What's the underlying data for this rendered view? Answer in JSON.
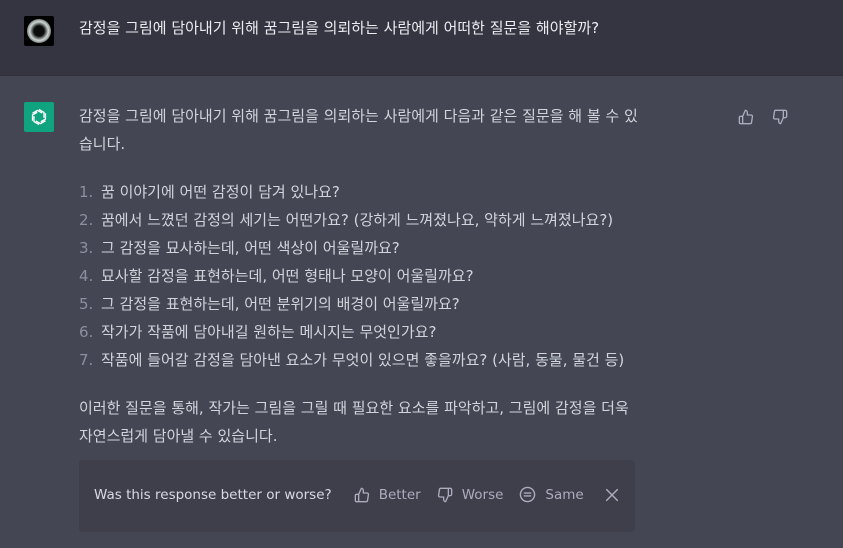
{
  "user_message": {
    "avatar": "user-avatar-orb",
    "text": "감정을 그림에 담아내기 위해 꿈그림을 의뢰하는 사람에게 어떠한 질문을 해야할까?"
  },
  "assistant_message": {
    "avatar": "openai-logo-icon",
    "accent_color": "#10a37f",
    "intro_line1": "감정을 그림에 담아내기 위해 꿈그림을 의뢰하는 사람에게 다음과 같은 질문을 해 볼 수 있",
    "intro_line2": "습니다.",
    "questions": [
      {
        "num": "1.",
        "text": "꿈 이야기에 어떤 감정이 담겨 있나요?"
      },
      {
        "num": "2.",
        "text": "꿈에서 느꼈던 감정의 세기는 어떤가요? (강하게 느껴졌나요, 약하게 느껴졌나요?)"
      },
      {
        "num": "3.",
        "text": "그 감정을 묘사하는데, 어떤 색상이 어울릴까요?"
      },
      {
        "num": "4.",
        "text": "묘사할 감정을 표현하는데, 어떤 형태나 모양이 어울릴까요?"
      },
      {
        "num": "5.",
        "text": "그 감정을 표현하는데, 어떤 분위기의 배경이 어울릴까요?"
      },
      {
        "num": "6.",
        "text": "작가가 작품에 담아내길 원하는 메시지는 무엇인가요?"
      },
      {
        "num": "7.",
        "text": "작품에 들어갈 감정을 담아낸 요소가 무엇이 있으면 좋을까요? (사람, 동물, 물건 등)"
      }
    ],
    "conclusion_line1": "이러한 질문을 통해, 작가는 그림을 그릴 때 필요한 요소를 파악하고, 그림에 감정을 더욱",
    "conclusion_line2": "자연스럽게 담아낼 수 있습니다."
  },
  "feedback": {
    "question": "Was this response better or worse?",
    "better_label": "Better",
    "worse_label": "Worse",
    "same_label": "Same"
  }
}
